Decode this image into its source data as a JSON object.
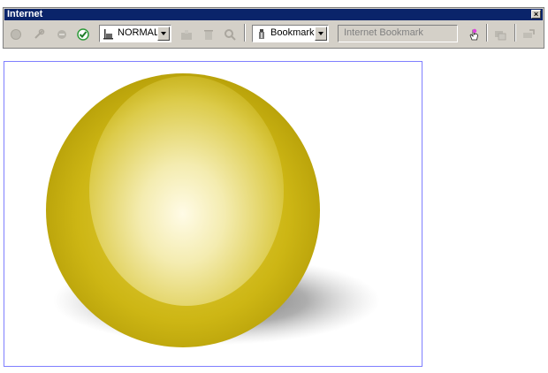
{
  "window": {
    "title": "Internet"
  },
  "toolbar": {
    "mode_combo": {
      "value": "NORMAL"
    },
    "bookmark_combo": {
      "value": "Bookmark"
    },
    "bookmark_field": {
      "value": "Internet Bookmark"
    }
  },
  "colors": {
    "titlebar": "#0a246a",
    "toolbar_face": "#d4d0c8",
    "canvas_border": "#7f7fff",
    "sphere_yellow": "#c8b400"
  },
  "icons": [
    "web-back-icon",
    "web-refresh-icon",
    "web-stop-icon",
    "check-icon",
    "flag-icon",
    "add-bookmark-icon",
    "delete-bookmark-icon",
    "search-bookmark-icon",
    "bookmark-pin-icon",
    "hand-pointer-icon",
    "link-icon",
    "unlink-icon"
  ]
}
